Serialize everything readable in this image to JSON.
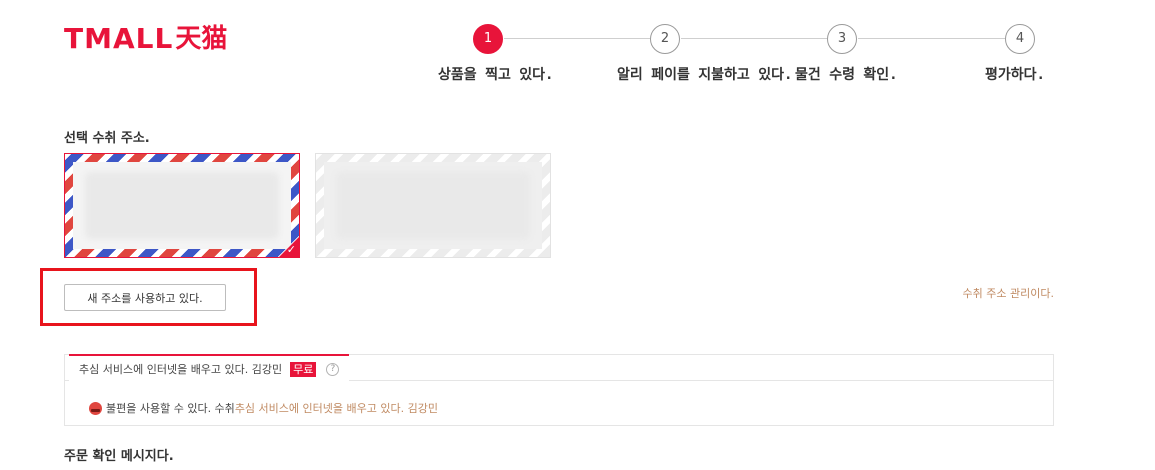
{
  "brand": {
    "latin": "TMALL",
    "cn": "天猫",
    "color": "#e8143a"
  },
  "steps": [
    {
      "number": "1",
      "label": "상품을 찍고 있다.",
      "active": true
    },
    {
      "number": "2",
      "label": "알리 페이를 지불하고 있다.",
      "active": false
    },
    {
      "number": "3",
      "label": "물건 수령 확인.",
      "active": false
    },
    {
      "number": "4",
      "label": "평가하다.",
      "active": false
    }
  ],
  "address": {
    "title": "선택 수취 주소.",
    "new_address_button": "새 주소를 사용하고 있다.",
    "manage_link": "수취 주소 관리이다.",
    "check_icon": "✓"
  },
  "service": {
    "tab_label": "추심 서비스에 인터넷을 배우고 있다. 김강민",
    "free_badge": "무료",
    "help_icon": "?",
    "row_text": "불편을 사용할 수 있다. 수취",
    "row_link": "추심 서비스에 인터넷을 배우고 있다. 김강민"
  },
  "order": {
    "title": "주문 확인 메시지다."
  },
  "colors": {
    "accent": "#e8143a",
    "link": "#c08a62",
    "highlight": "#e8141c"
  }
}
